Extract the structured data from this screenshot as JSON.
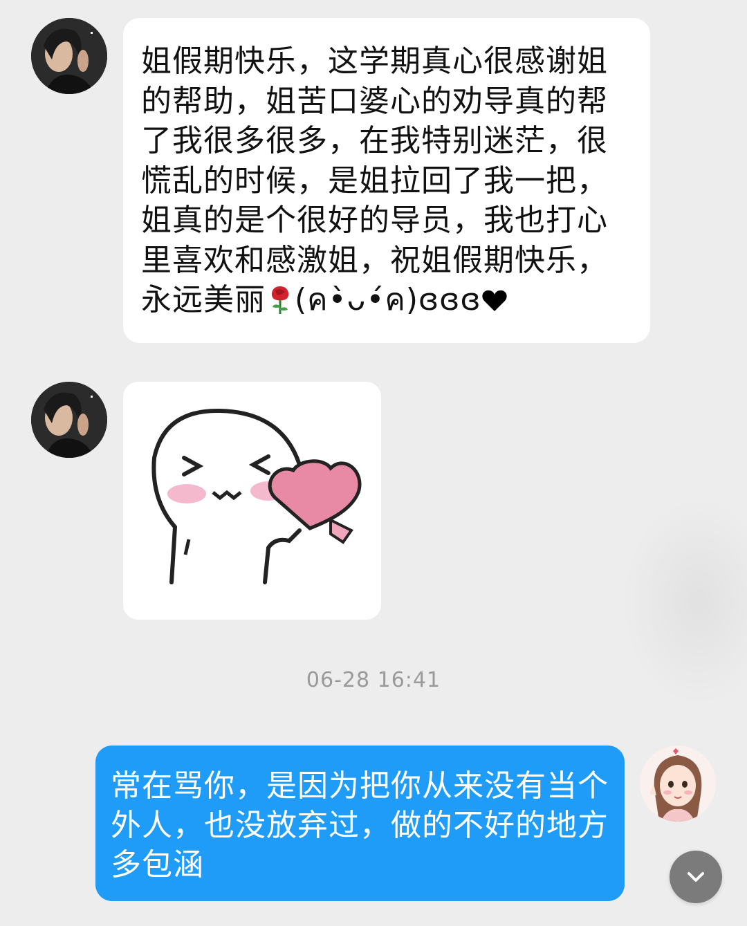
{
  "messages": [
    {
      "side": "left",
      "type": "text",
      "text": "姐假期快乐，这学期真心很感谢姐的帮助，姐苦口婆心的劝导真的帮了我很多很多，在我特别迷茫，很慌乱的时候，是姐拉回了我一把，姐真的是个很好的导员，我也打心里喜欢和感激姐，祝姐假期快乐，永远美丽",
      "emoji_after": "rose-emoji",
      "kaomoji": "(ค•̀ᴗ•́ค)ɞɞɞ",
      "emoji_end": "black-heart-emoji"
    },
    {
      "side": "left",
      "type": "sticker",
      "sticker_name": "hugging-heart-sticker"
    }
  ],
  "timestamp": "06-28 16:41",
  "reply": {
    "side": "right",
    "text": "常在骂你，是因为把你从来没有当个外人，也没放弃过，做的不好的地方多包涵"
  },
  "colors": {
    "background": "#ededed",
    "incoming_bubble": "#ffffff",
    "outgoing_bubble": "#1e9cf8",
    "timestamp_text": "#9a9a9a"
  },
  "icons": {
    "scroll_down": "chevron-down-icon"
  }
}
